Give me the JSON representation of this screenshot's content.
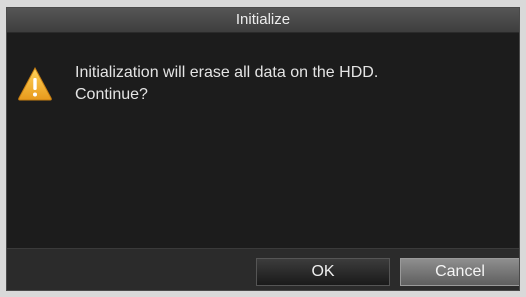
{
  "dialog": {
    "title": "Initialize",
    "icon": "warning-triangle-icon",
    "message_lines": [
      "Initialization will erase all data on the HDD.",
      "Continue?"
    ],
    "buttons": {
      "ok": "OK",
      "cancel": "Cancel"
    }
  },
  "colors": {
    "warning_yellow": "#f2b233",
    "dialog_background": "#1c1c1c",
    "title_bar": "#4a4a4a"
  }
}
